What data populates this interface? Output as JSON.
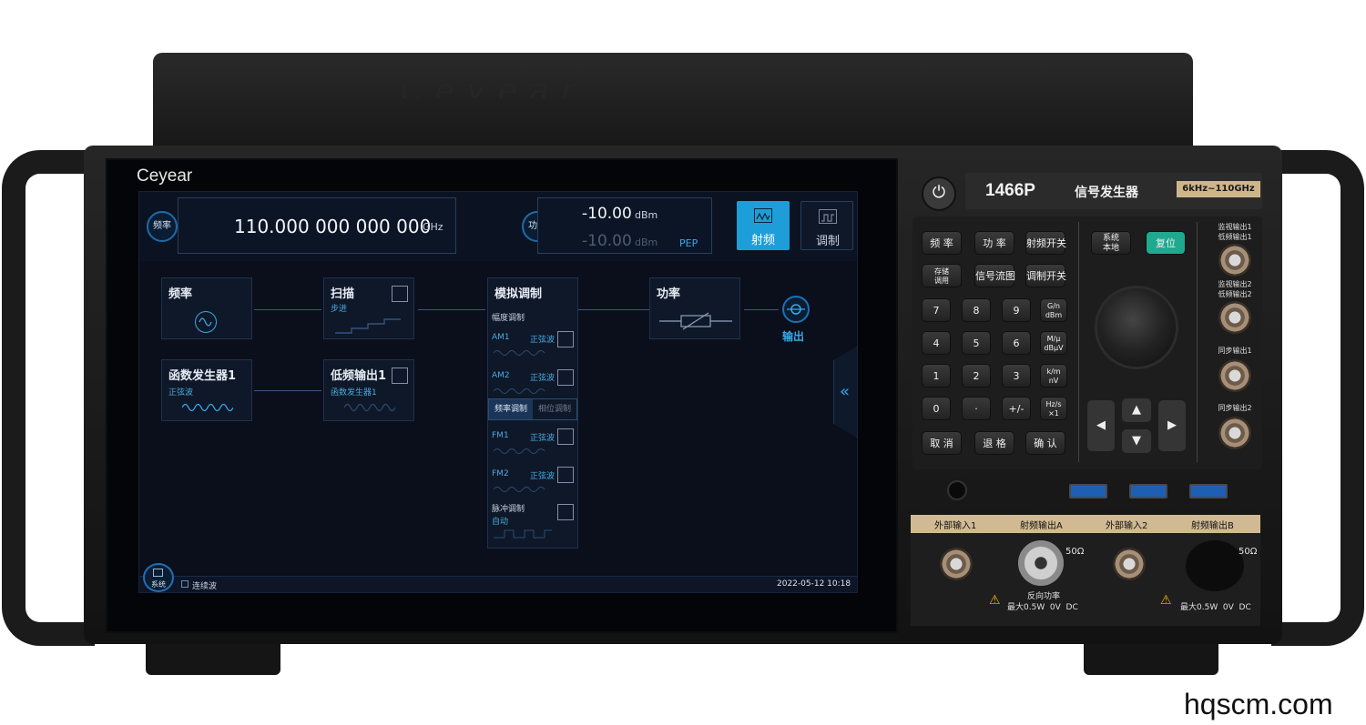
{
  "instrument": {
    "lid_brand": "Ceyear",
    "screen_logo": "Ceyear",
    "model": "1466P",
    "type": "信号发生器",
    "range": "6kHz~110GHz",
    "watermark": "hqscm.com"
  },
  "topbar": {
    "freq_label": "频率",
    "freq_value": "110.000 000 000 000",
    "freq_unit": "GHz",
    "power_label": "功率",
    "power_value": "-10.00",
    "power_unit": "dBm",
    "power_value2": "-10.00",
    "power_unit2": "dBm",
    "pep": "PEP",
    "rf_label": "射频",
    "mod_label": "调制"
  },
  "blocks": {
    "freq": {
      "title": "频率"
    },
    "sweep": {
      "title": "扫描",
      "sub": "步进"
    },
    "analog_mod": {
      "title": "模拟调制",
      "am_header": "幅度调制",
      "am1": "AM1",
      "am1_type": "正弦波",
      "am2": "AM2",
      "am2_type": "正弦波",
      "tab_fm": "频率调制",
      "tab_pm": "相位调制",
      "fm1": "FM1",
      "fm1_type": "正弦波",
      "fm2": "FM2",
      "fm2_type": "正弦波",
      "pulse": "脉冲调制",
      "pulse_mode": "自动"
    },
    "power": {
      "title": "功率"
    },
    "output": "输出",
    "funcgen": {
      "title": "函数发生器1",
      "sub": "正弦波"
    },
    "lfout": {
      "title": "低频输出1",
      "sub": "函数发生器1"
    }
  },
  "statusbar": {
    "system": "系统",
    "mode": "连续波",
    "datetime": "2022-05-12 10:18"
  },
  "keys": {
    "row1": [
      "频 率",
      "功 率",
      "射频开关"
    ],
    "row2": [
      "存储\n调用",
      "信号流图",
      "调制开关"
    ],
    "nums": [
      [
        "7",
        "8",
        "9",
        "G/n\ndBm"
      ],
      [
        "4",
        "5",
        "6",
        "M/μ\ndBμV"
      ],
      [
        "1",
        "2",
        "3",
        "k/m\nnV"
      ],
      [
        "0",
        "·",
        "+/-",
        "Hz/s\n×1"
      ]
    ],
    "row_last": [
      "取 消",
      "退 格",
      "确 认"
    ],
    "sys_local": "系统\n本地",
    "reset": "复位"
  },
  "ports_right": [
    "监视输出1\n低频输出1",
    "监视输出2\n低频输出2",
    "同步输出1",
    "同步输出2"
  ],
  "bottom": {
    "ext_in1": "外部输入1",
    "rf_out_a": "射频输出A",
    "ext_in2": "外部输入2",
    "rf_out_b": "射频输出B",
    "ohm_a": "50Ω",
    "ohm_b": "50Ω",
    "rev_power": "反向功率",
    "max_a": "最大0.5W  0V  DC",
    "max_b": "最大0.5W  0V  DC"
  }
}
